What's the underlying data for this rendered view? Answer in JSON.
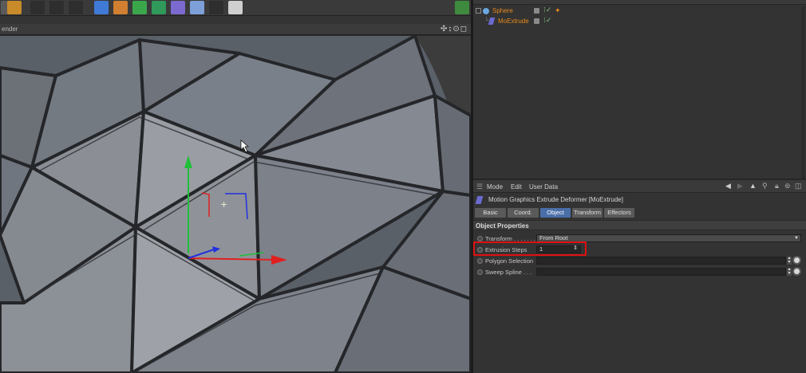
{
  "viewport": {
    "label": "ender",
    "nav_icons": "✣↕⊙◻"
  },
  "object_manager": {
    "objects": [
      {
        "name": "Sphere"
      },
      {
        "name": "MoExtrude"
      }
    ]
  },
  "attribute_manager": {
    "menu": [
      "Mode",
      "Edit",
      "User Data"
    ],
    "title": "Motion Graphics Extrude Deformer [MoExtrude]",
    "tabs": [
      "Basic",
      "Coord.",
      "Object",
      "Transform",
      "Effectors"
    ],
    "active_tab": "Object",
    "section_title": "Object Properties",
    "params": {
      "transform": {
        "label": "Transform . . . . . . .",
        "value": "From Root"
      },
      "extrusion_steps": {
        "label": "Extrusion Steps",
        "value": "1"
      },
      "polygon_selection": {
        "label": "Polygon Selection",
        "value": ""
      },
      "sweep_spline": {
        "label": "Sweep Spline . . .",
        "value": ""
      }
    }
  },
  "colors": {
    "highlight": "#e01010",
    "active_tab": "#4a6ea8",
    "object_name": "#e88a1a",
    "axis_y": "#1fbf3a",
    "axis_x": "#e02020",
    "axis_z": "#2030e0"
  }
}
